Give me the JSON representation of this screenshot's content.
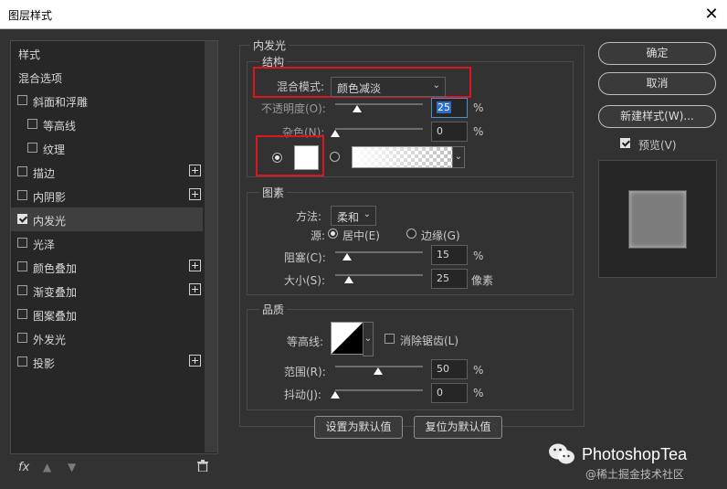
{
  "window": {
    "title": "图层样式"
  },
  "styles_list": [
    {
      "label": "样式",
      "checkbox": false,
      "plus": false,
      "indent": false,
      "checked": false,
      "selected": false
    },
    {
      "label": "混合选项",
      "checkbox": false,
      "plus": false,
      "indent": false,
      "checked": false,
      "selected": false
    },
    {
      "label": "斜面和浮雕",
      "checkbox": true,
      "plus": false,
      "indent": false,
      "checked": false,
      "selected": false
    },
    {
      "label": "等高线",
      "checkbox": true,
      "plus": false,
      "indent": true,
      "checked": false,
      "selected": false
    },
    {
      "label": "纹理",
      "checkbox": true,
      "plus": false,
      "indent": true,
      "checked": false,
      "selected": false
    },
    {
      "label": "描边",
      "checkbox": true,
      "plus": true,
      "indent": false,
      "checked": false,
      "selected": false
    },
    {
      "label": "内阴影",
      "checkbox": true,
      "plus": true,
      "indent": false,
      "checked": false,
      "selected": false
    },
    {
      "label": "内发光",
      "checkbox": true,
      "plus": false,
      "indent": false,
      "checked": true,
      "selected": true
    },
    {
      "label": "光泽",
      "checkbox": true,
      "plus": false,
      "indent": false,
      "checked": false,
      "selected": false
    },
    {
      "label": "颜色叠加",
      "checkbox": true,
      "plus": true,
      "indent": false,
      "checked": false,
      "selected": false
    },
    {
      "label": "渐变叠加",
      "checkbox": true,
      "plus": true,
      "indent": false,
      "checked": false,
      "selected": false
    },
    {
      "label": "图案叠加",
      "checkbox": true,
      "plus": false,
      "indent": false,
      "checked": false,
      "selected": false
    },
    {
      "label": "外发光",
      "checkbox": true,
      "plus": false,
      "indent": false,
      "checked": false,
      "selected": false
    },
    {
      "label": "投影",
      "checkbox": true,
      "plus": true,
      "indent": false,
      "checked": false,
      "selected": false
    }
  ],
  "bottom_icons": {
    "fx": "fx"
  },
  "inner_glow": {
    "title": "内发光",
    "structure": {
      "title": "结构",
      "blend_mode_label": "混合模式:",
      "blend_mode_value": "颜色减淡",
      "opacity_label": "不透明度(O):",
      "opacity_value": "25",
      "opacity_unit": "%",
      "noise_label": "杂色(N):",
      "noise_value": "0",
      "noise_unit": "%",
      "glow_color": "#ffffff"
    },
    "elements": {
      "title": "图素",
      "method_label": "方法:",
      "method_value": "柔和",
      "source_label": "源:",
      "source_center": "居中(E)",
      "source_edge": "边缘(G)",
      "choke_label": "阻塞(C):",
      "choke_value": "15",
      "choke_unit": "%",
      "size_label": "大小(S):",
      "size_value": "25",
      "size_unit": "像素"
    },
    "quality": {
      "title": "品质",
      "contour_label": "等高线:",
      "antialias_label": "消除锯齿(L)",
      "range_label": "范围(R):",
      "range_value": "50",
      "range_unit": "%",
      "jitter_label": "抖动(J):",
      "jitter_value": "0",
      "jitter_unit": "%"
    },
    "set_default": "设置为默认值",
    "reset_default": "复位为默认值"
  },
  "buttons": {
    "ok": "确定",
    "cancel": "取消",
    "new_style": "新建样式(W)...",
    "preview": "预览(V)"
  },
  "watermark": {
    "brand": "PhotoshopTea",
    "site": "@稀土掘金技术社区"
  },
  "colors": {
    "highlight_red": "#e0141e",
    "panel_bg": "#323232"
  }
}
